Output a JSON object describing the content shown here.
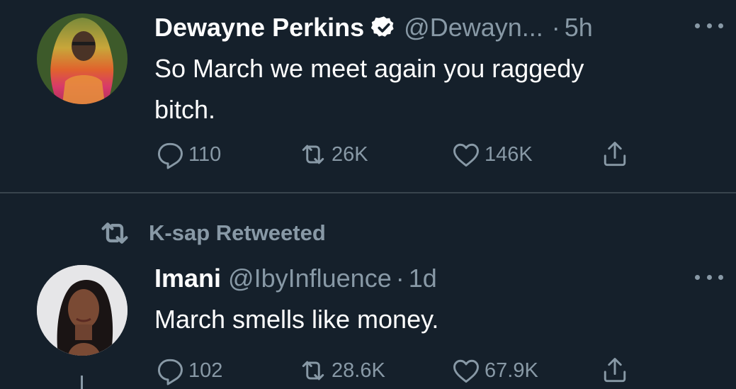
{
  "tweets": [
    {
      "name": "Dewayne Perkins",
      "verified": true,
      "handle": "@Dewayn...",
      "separator": "·",
      "time": "5h",
      "text": "So March we meet again you raggedy\nbitch.",
      "replies": "110",
      "retweets": "26K",
      "likes": "146K",
      "icons": [
        "reply-icon",
        "retweet-icon",
        "like-icon",
        "share-icon"
      ]
    },
    {
      "retweeted_by": "K-sap Retweeted",
      "name": "Imani",
      "handle": "@IbyInfluence",
      "separator": "·",
      "time": "1d",
      "text": "March smells like money.",
      "replies": "102",
      "retweets": "28.6K",
      "likes": "67.9K",
      "icons": [
        "reply-icon",
        "retweet-icon",
        "like-icon",
        "share-icon"
      ]
    }
  ],
  "colors": {
    "background": "#15202b",
    "secondary_text": "#8899a6",
    "divider": "#38444d",
    "verified_badge": "#ffffff"
  }
}
